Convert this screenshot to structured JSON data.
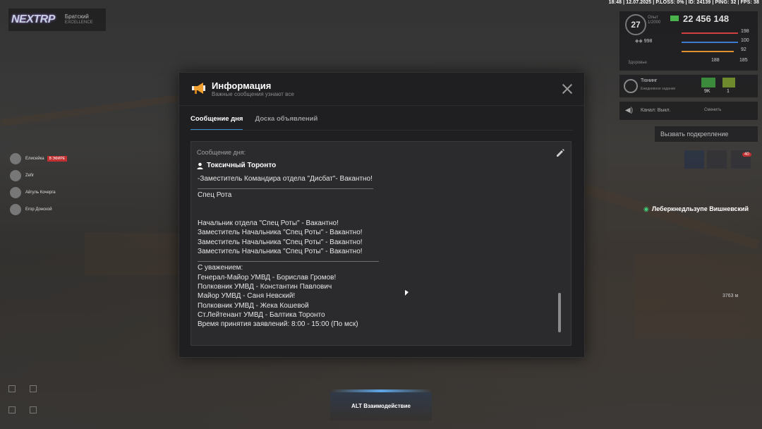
{
  "topbar": {
    "stats": "18:48 | 12.07.2025 | P.LOSS: 0% | ID: 24139 | PING: 32 | FPS: 38"
  },
  "logo": {
    "mark": "NEXTRP",
    "server": "Братский",
    "sub": "EXCELLENCE"
  },
  "hud": {
    "level": "27",
    "level_sub1": "Опыт",
    "level_sub2": "1/2000",
    "money": "22 456 148",
    "speed": "998",
    "heart_label": "Здоровье",
    "stat_health": "198",
    "stat_food": "100",
    "stat_drink": "92",
    "stat_a": "188",
    "stat_b": "185",
    "colors": {
      "red": "#d04040",
      "blue": "#3d7ad0",
      "orange": "#e09030",
      "green": "#4bb34b"
    }
  },
  "tuning": {
    "title": "Тюнинг",
    "subtitle": "Ежедневное задание",
    "cash_value": "9K",
    "gold_value": "1"
  },
  "channel": {
    "label": "Канал: Выкл.",
    "switch": "Сменить"
  },
  "backup_button": "Вызвать подкрепление",
  "badge_count": "40",
  "player_label": "Леберкнедльзупе Вишневский",
  "distance": "3763 м",
  "voice_list": [
    {
      "name": "Елисейка",
      "tag": "В ЭФИРЕ"
    },
    {
      "name": "Zefir",
      "tag": ""
    },
    {
      "name": "Айгуль Кочерга",
      "tag": ""
    },
    {
      "name": "Егор Донской",
      "tag": ""
    }
  ],
  "modal": {
    "title": "Информация",
    "subtitle": "Важные сообщения узнают все",
    "tabs": [
      {
        "label": "Сообщение дня",
        "active": true
      },
      {
        "label": "Доска объявлений",
        "active": false
      }
    ],
    "content_label": "Сообщение дня:",
    "author": "Токсичный Торонто",
    "lines": [
      "-Заместитель Командира отдела \"Дисбат\"- Вакантно!",
      "________________________________________________________________",
      "Спец Рота",
      "",
      "",
      "Начальник отдела \"Спец Роты\" - Вакантно!",
      "Заместитель Начальника \"Спец Роты\" - Вакантно!",
      "Заместитель Начальника \"Спец Роты\" - Вакантно!",
      "Заместитель Начальника \"Спец Роты\" - Вакантно!",
      "__________________________________________________________________",
      "С уважением:",
      "Генерал-Майор УМВД - Борислав Громов!",
      "Полковник УМВД - Константин Павлович",
      "Майор УМВД - Саня Невский!",
      "Полковник УМВД - Жека Кошевой",
      "Ст.Лейтенант УМВД - Балтика Торонто",
      "Время принятия заявлений: 8:00 - 15:00 (По мск)"
    ]
  },
  "interact_hint": "ALT Взаимодействие"
}
